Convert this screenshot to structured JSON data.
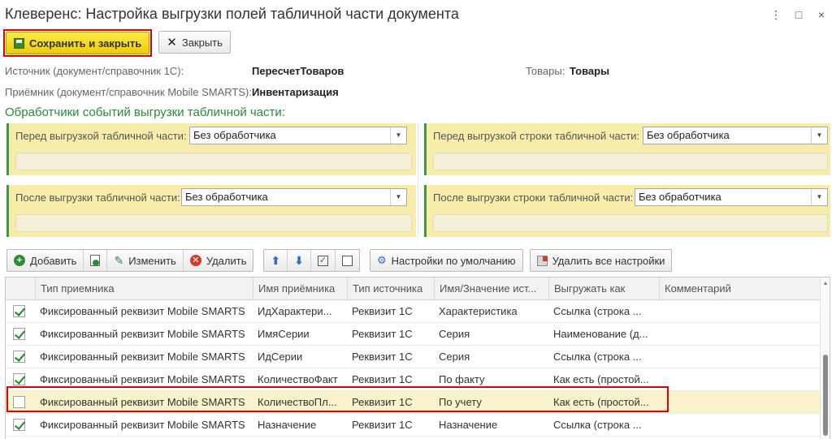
{
  "window": {
    "title": "Клеверенс: Настройка выгрузки полей табличной части документа",
    "menu_glyph": "⋮",
    "max_glyph": "□",
    "close_glyph": "×"
  },
  "toolbar": {
    "save_close_label": "Сохранить и закрыть",
    "close_label": "Закрыть"
  },
  "info": {
    "source_label": "Источник (документ/справочник 1С):",
    "source_value": "ПересчетТоваров",
    "goods_label": "Товары:",
    "goods_value": "Товары",
    "receiver_label": "Приёмник (документ/справочник Mobile SMARTS):",
    "receiver_value": "Инвентаризация"
  },
  "handlers": {
    "section_title": "Обработчики событий выгрузки табличной части:",
    "before_table_label": "Перед выгрузкой табличной части:",
    "before_table_value": "Без обработчика",
    "before_row_label": "Перед выгрузкой строки табличной части:",
    "before_row_value": "Без обработчика",
    "after_table_label": "После выгрузки табличной части:",
    "after_table_value": "Без обработчика",
    "after_row_label": "После выгрузки строки табличной части:",
    "after_row_value": "Без обработчика"
  },
  "actions": {
    "add_label": "Добавить",
    "edit_label": "Изменить",
    "delete_label": "Удалить",
    "defaults_label": "Настройки по умолчанию",
    "delete_all_label": "Удалить все настройки"
  },
  "table": {
    "columns": [
      "Тип приемника",
      "Имя приёмника",
      "Тип источника",
      "Имя/Значение ист...",
      "Выгружать как",
      "Комментарий"
    ],
    "rows": [
      {
        "checked": true,
        "cells": [
          "Фиксированный реквизит Mobile SMARTS",
          "ИдХарактери...",
          "Реквизит 1С",
          "Характеристика",
          "Ссылка (строка ...",
          ""
        ]
      },
      {
        "checked": true,
        "cells": [
          "Фиксированный реквизит Mobile SMARTS",
          "ИмяСерии",
          "Реквизит 1С",
          "Серия",
          "Наименование (д...",
          ""
        ]
      },
      {
        "checked": true,
        "cells": [
          "Фиксированный реквизит Mobile SMARTS",
          "ИдСерии",
          "Реквизит 1С",
          "Серия",
          "Ссылка (строка ...",
          ""
        ]
      },
      {
        "checked": true,
        "cells": [
          "Фиксированный реквизит Mobile SMARTS",
          "КоличествоФакт",
          "Реквизит 1С",
          "По факту",
          "Как есть (простой...",
          ""
        ]
      },
      {
        "checked": false,
        "cells": [
          "Фиксированный реквизит Mobile SMARTS",
          "КоличествоПл...",
          "Реквизит 1С",
          "По учету",
          "Как есть (простой...",
          ""
        ]
      },
      {
        "checked": true,
        "cells": [
          "Фиксированный реквизит Mobile SMARTS",
          "Назначение",
          "Реквизит 1С",
          "Назначение",
          "Ссылка (строка ...",
          ""
        ]
      }
    ]
  },
  "colors": {
    "accent_green": "#2a8a3a",
    "panel_yellow": "#f7ecaa",
    "highlight_red": "#e00000",
    "primary_button": "#f0cc00"
  }
}
